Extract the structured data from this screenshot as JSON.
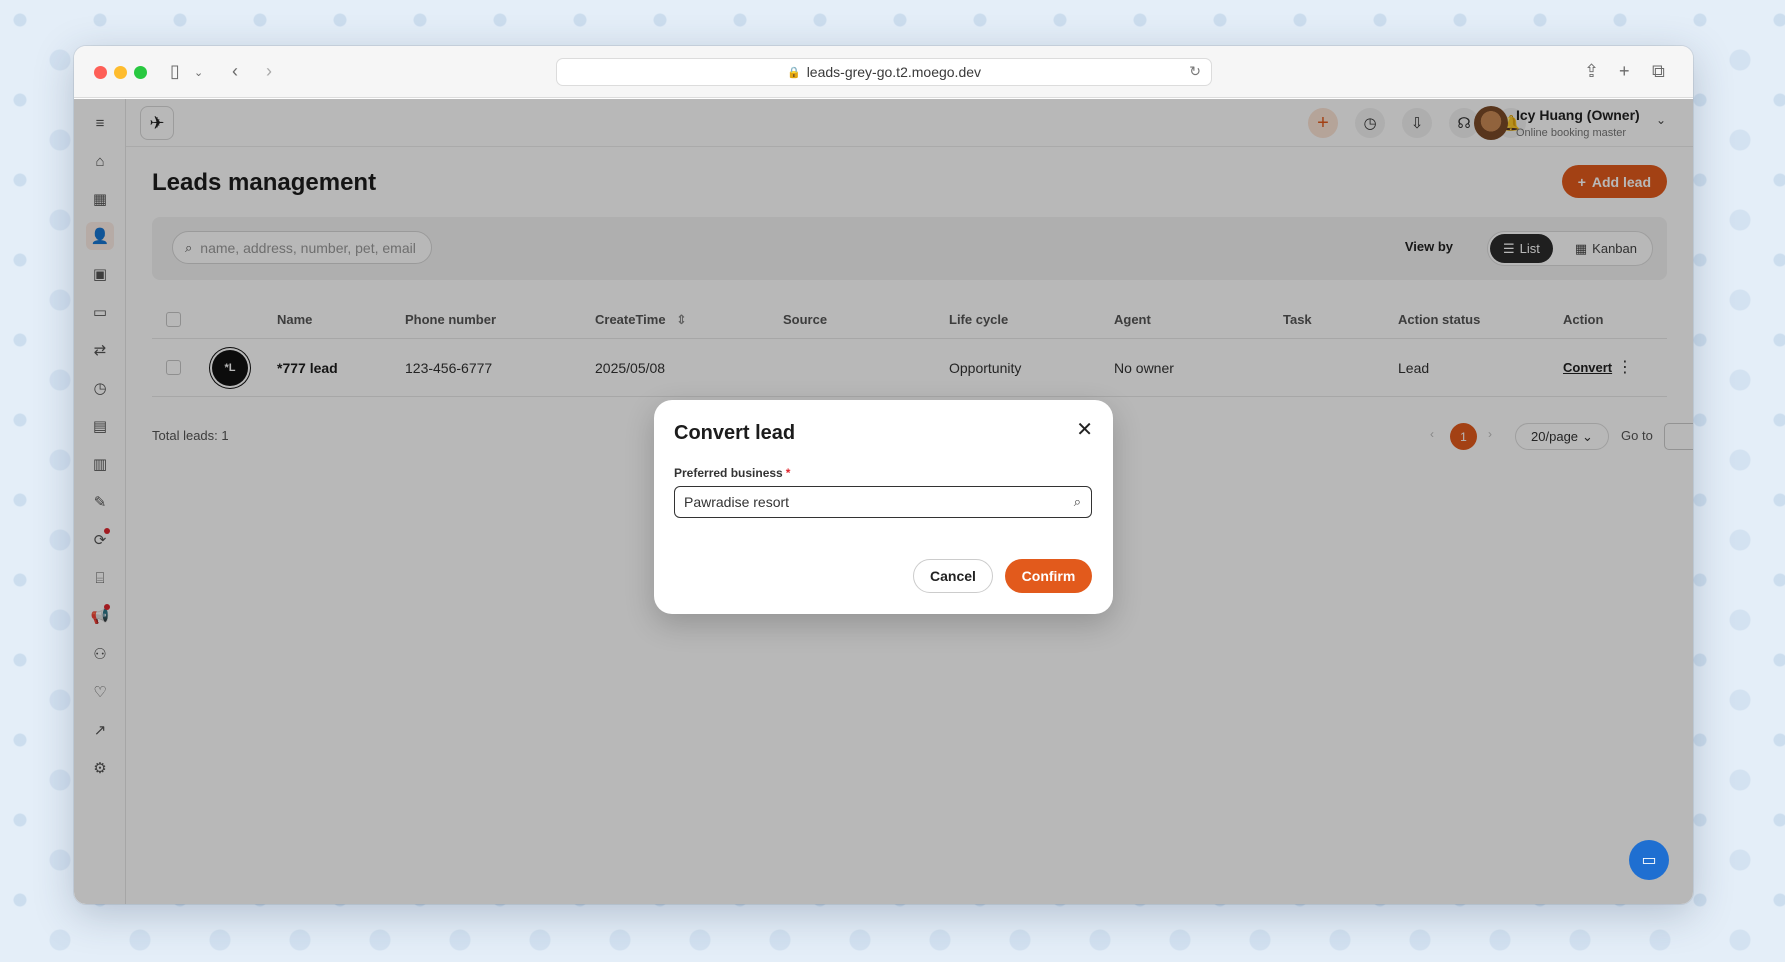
{
  "browser": {
    "url": "leads-grey-go.t2.moego.dev",
    "icons": [
      "sidebar-toggle-icon",
      "back-icon",
      "forward-icon",
      "lock-icon",
      "reload-icon",
      "share-icon",
      "new-tab-icon",
      "tabs-overview-icon"
    ]
  },
  "sidebar": {
    "items": [
      {
        "icon": "menu-icon",
        "active": false
      },
      {
        "icon": "home-icon",
        "active": false
      },
      {
        "icon": "calendar-icon",
        "active": false
      },
      {
        "icon": "leads-icon",
        "active": true
      },
      {
        "icon": "bag-icon",
        "active": false
      },
      {
        "icon": "message-icon",
        "active": false
      },
      {
        "icon": "route-icon",
        "active": false
      },
      {
        "icon": "alarm-icon",
        "active": false
      },
      {
        "icon": "card-icon",
        "active": false
      },
      {
        "icon": "clipboard-icon",
        "active": false
      },
      {
        "icon": "pen-icon",
        "active": false
      },
      {
        "icon": "automation-icon",
        "active": false,
        "badge": true
      },
      {
        "icon": "bank-icon",
        "active": false
      },
      {
        "icon": "megaphone-icon",
        "active": false,
        "badge": true
      },
      {
        "icon": "people-icon",
        "active": false
      },
      {
        "icon": "heart-shield-icon",
        "active": false
      },
      {
        "icon": "chart-icon",
        "active": false
      },
      {
        "icon": "settings-icon",
        "active": false
      }
    ]
  },
  "topbar": {
    "user_name": "Icy Huang (Owner)",
    "user_role": "Online booking master"
  },
  "page": {
    "title": "Leads management",
    "add_lead_label": "Add lead",
    "search_placeholder": "name, address, number, pet, email",
    "view_by_label": "View by",
    "view_list": "List",
    "view_kanban": "Kanban"
  },
  "table": {
    "headers": {
      "name": "Name",
      "phone": "Phone number",
      "create_time": "CreateTime",
      "source": "Source",
      "life_cycle": "Life cycle",
      "agent": "Agent",
      "task": "Task",
      "action_status": "Action status",
      "action": "Action"
    },
    "rows": [
      {
        "avatar_initials": "*L",
        "name": "*777 lead",
        "phone": "123-456-6777",
        "create_time": "2025/05/08",
        "source": "",
        "life_cycle": "Opportunity",
        "agent": "No owner",
        "task": "",
        "action_status": "Lead",
        "action_label": "Convert"
      }
    ],
    "total": "Total leads: 1"
  },
  "pagination": {
    "current_page": "1",
    "page_size": "20/page",
    "goto_label": "Go to"
  },
  "modal": {
    "title": "Convert lead",
    "field_label": "Preferred business",
    "field_required_mark": "*",
    "field_value": "Pawradise resort",
    "cancel_label": "Cancel",
    "confirm_label": "Confirm"
  },
  "colors": {
    "accent": "#e25a1c",
    "dark": "#2b2b2b",
    "chat": "#1f6fd1"
  }
}
